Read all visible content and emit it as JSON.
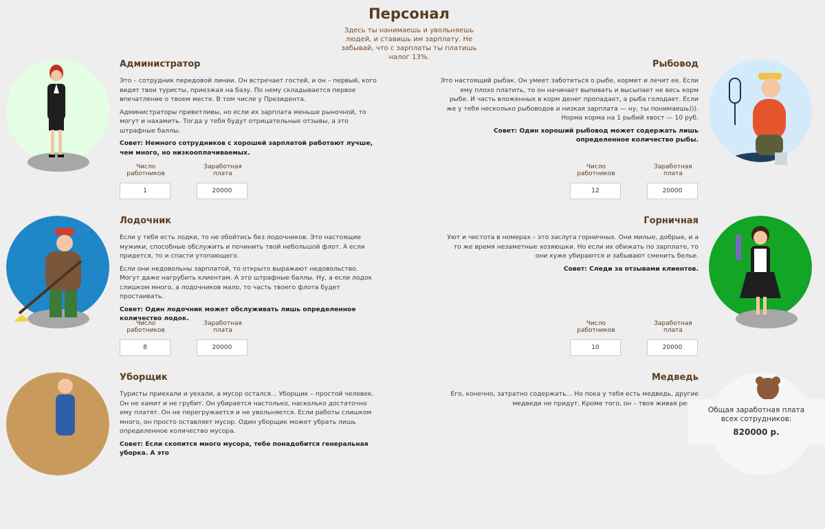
{
  "page": {
    "title": "Персонал",
    "subtitle": "Здесь ты нанимаешь и увольняешь людей, и ставишь им зарплату. Не забывай, что с зарплаты ты платишь налог 13%."
  },
  "labels": {
    "workers": "Число работников",
    "salary": "Заработная плата"
  },
  "staff": [
    {
      "title": "Администратор",
      "paragraphs": [
        "Это – сотрудник передовой линии. Он встречает гостей, и он – первый, кого видят твои туристы, приезжая на базу. По нему складывается первое впечатление о твоем месте. В том числе у Президента.",
        "Администраторы приветливы, но если их зарплата меньше рыночной, то могут и нахамить. Тогда у тебя будут отрицательные отзывы, а это штрафные баллы."
      ],
      "tip": "Совет: Немного сотрудников с хорошей зарплатой работают лучше, чем много, но низкооплачиваемых.",
      "workers": "1",
      "salary": "20000",
      "avatar_color": "#e4ffe4"
    },
    {
      "title": "Рыбовод",
      "paragraphs": [
        "Это настоящий рыбак. Он умеет заботиться о рыбе, кормит и лечит ее. Если ему плохо платить, то он начинает выпивать и высыпает не весь корм рыбе. И часть вложенных в корм денег пропадает, а рыба голодает. Если же у тебя несколько рыбоводов и низкая зарплата — ну, ты понимаешь))). Норма корма на 1 рыбий хвост — 10 руб."
      ],
      "tip": "Совет: Один хороший рыбовод может содержать лишь определенное количество рыбы.",
      "workers": "12",
      "salary": "20000",
      "avatar_color": "#d3eafb"
    },
    {
      "title": "Лодочник",
      "paragraphs": [
        "Если у тебя есть лодки, то не обойтись без лодочников. Это настоящие мужики, способные обслужить и починить твой небольшой флот. А если придется, то и спасти утопающего.",
        "Если они недовольны зарплатой, то открыто выражают недовольство. Могут даже нагрубить клиентам. А это штрафные баллы. Ну, а если лодок слишком много, а лодочников мало, то часть твоего флота будет простаивать."
      ],
      "tip": "Совет: Один лодочник может обслуживать лишь определенное количество лодок.",
      "workers": "8",
      "salary": "20000",
      "avatar_color": "#1f86c8"
    },
    {
      "title": "Горничная",
      "paragraphs": [
        "Уют и чистота в номерах – это заслуга горничных. Они милые, добрые, и а то же время незаметные хозяюшки. Но если их обижать по зарплате, то они хуже убираются и забывают сменить белье."
      ],
      "tip": "Совет: Следи за отзывами клиентов.",
      "workers": "10",
      "salary": "20000",
      "avatar_color": "#12a526"
    },
    {
      "title": "Уборщик",
      "paragraphs": [
        "Туристы приехали и уехали, а мусор остался... Уборщик – простой человек. Он не хамит и не грубит. Он убирается настолько, насколько достаточно ему платят. Он не перегружается и не увольняется. Если работы слишком много, он просто оставляет мусор. Один уборщик может убрать лишь определенное количество мусора."
      ],
      "tip": "Совет: Если скопится много мусора, тебе понадобится генеральная уборка. А это",
      "avatar_color": "#c89a5c"
    },
    {
      "title": "Медведь",
      "paragraphs": [
        "Его, конечно, затратно содержать... Но пока у тебя есть медведь, другие медведи не придут. Кроме того, он – твоя живая рекла"
      ],
      "avatar_color": "#f6f6f6"
    }
  ],
  "summary": {
    "label": "Общая заработная плата всех сотрудников:",
    "value": "820000 р."
  }
}
